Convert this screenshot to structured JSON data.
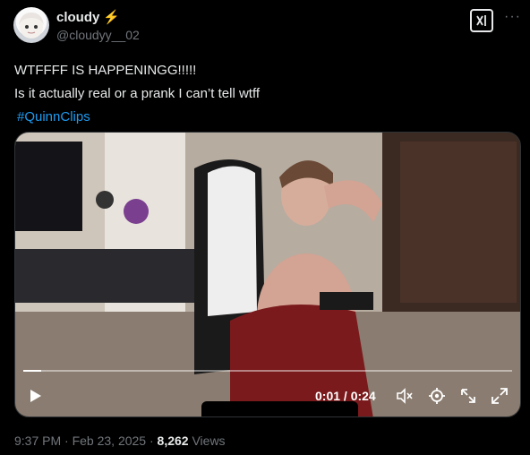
{
  "author": {
    "display_name": "cloudy",
    "badge": "⚡",
    "handle": "@cloudyy__02"
  },
  "tweet": {
    "line1": "WTFFFF IS HAPPENINGG!!!!!",
    "line2": "Is it actually real or a prank I can’t tell wtff",
    "hashtag": "#QuinnClips"
  },
  "video": {
    "time": "0:01 / 0:24",
    "progress": 0.036
  },
  "footer": {
    "timestamp": "9:37 PM · Feb 23, 2025 · ",
    "views_count": "8,262",
    "views_label": " Views"
  },
  "icons": {
    "grok": "grok-icon",
    "more": "more-icon",
    "play": "play-icon",
    "mute": "mute-icon",
    "settings": "settings-icon",
    "pip": "picture-in-picture-icon",
    "fullscreen": "fullscreen-icon"
  },
  "colors": {
    "accent": "#1d9bf0",
    "secondary_text": "#71767b",
    "primary_text": "#e7e9ea"
  }
}
